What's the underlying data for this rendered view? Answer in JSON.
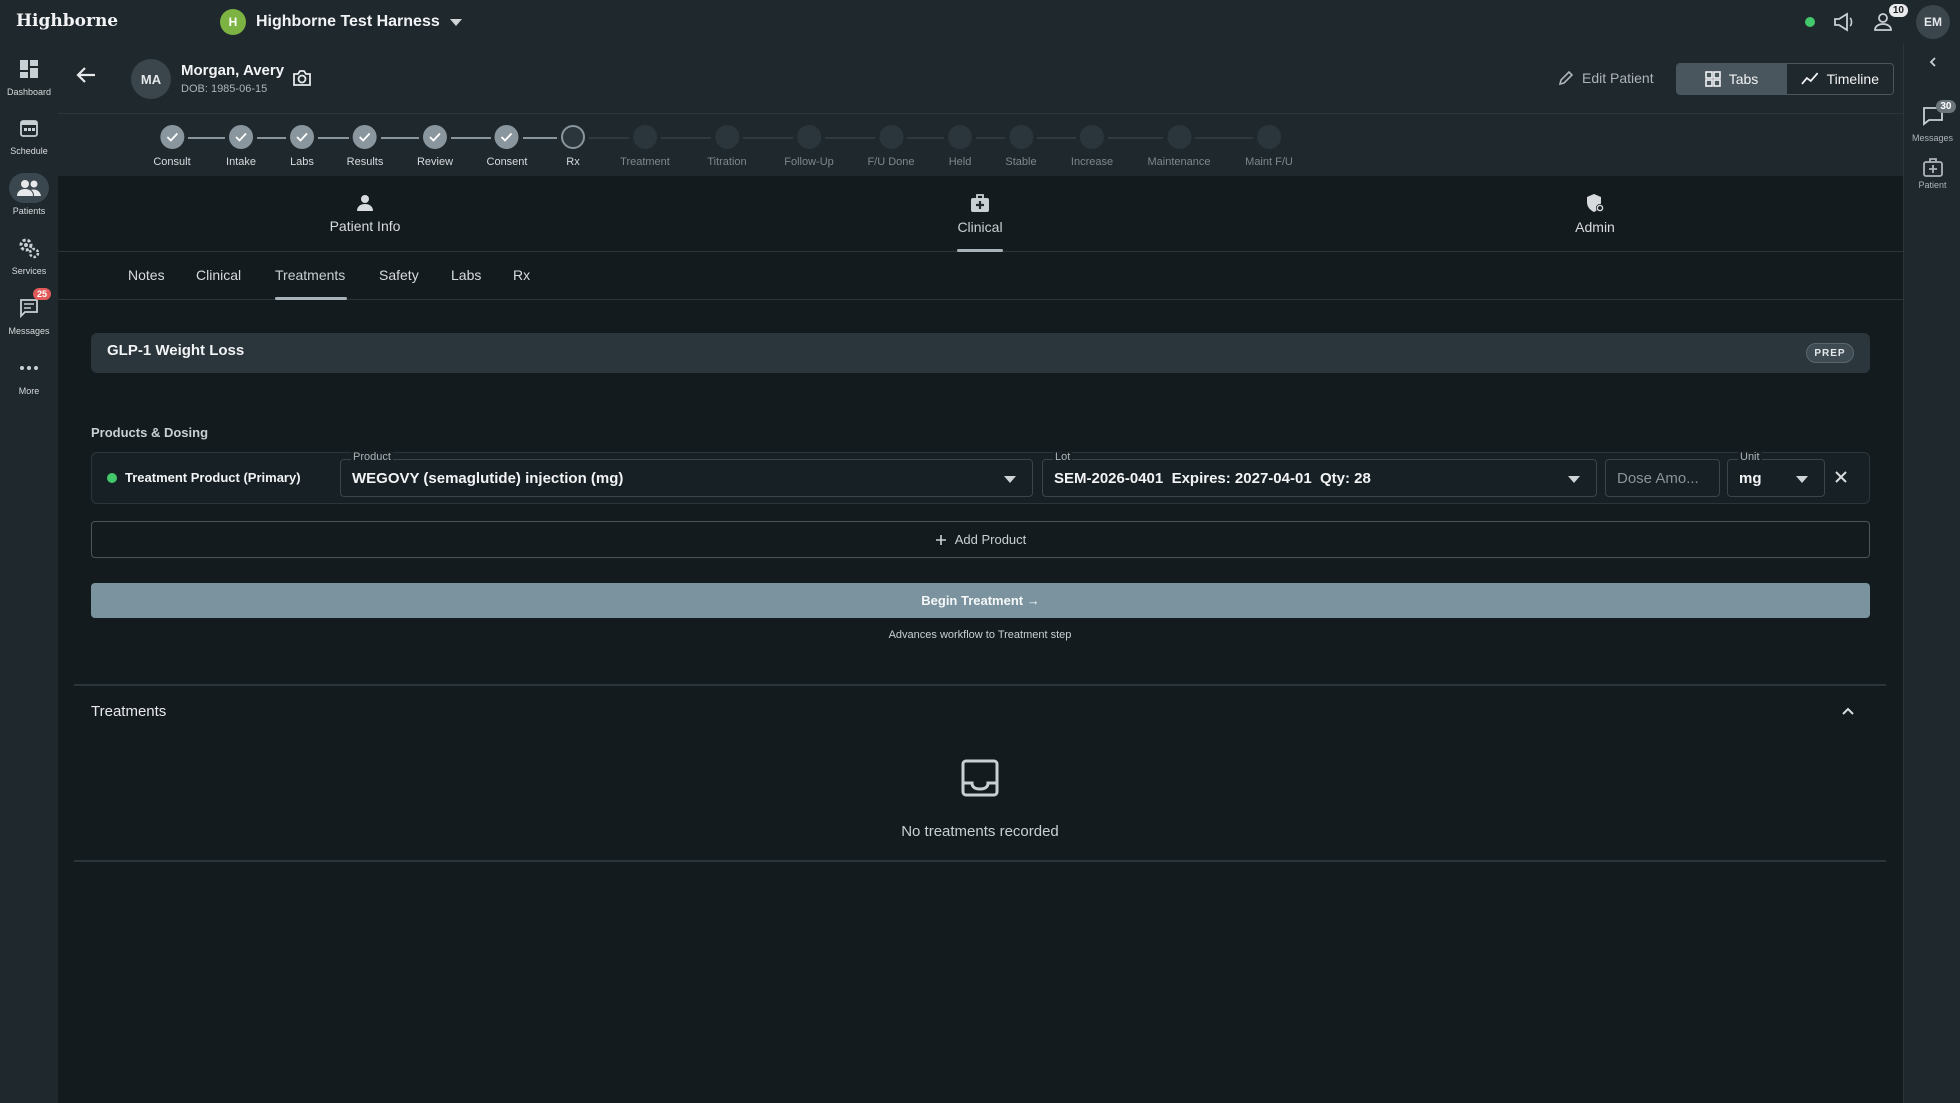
{
  "topbar": {
    "logo": "Highborne",
    "org_initial": "H",
    "org_name": "Highborne Test Harness",
    "notifications_count": "10",
    "user_initials": "EM"
  },
  "left_nav": [
    {
      "label": "Dashboard",
      "icon": "dashboard-icon"
    },
    {
      "label": "Schedule",
      "icon": "calendar-icon"
    },
    {
      "label": "Patients",
      "icon": "patients-icon",
      "active": true
    },
    {
      "label": "Services",
      "icon": "gears-icon"
    },
    {
      "label": "Messages",
      "icon": "chat-icon",
      "badge": "25"
    },
    {
      "label": "More",
      "icon": "more-icon"
    }
  ],
  "right_rail": {
    "messages_label": "Messages",
    "messages_badge": "30",
    "patient_label": "Patient"
  },
  "patient": {
    "initials": "MA",
    "name": "Morgan, Avery",
    "dob": "DOB: 1985-06-15"
  },
  "header_actions": {
    "edit_patient": "Edit Patient",
    "tabs_label": "Tabs",
    "timeline_label": "Timeline"
  },
  "workflow_steps": [
    {
      "label": "Consult",
      "state": "done"
    },
    {
      "label": "Intake",
      "state": "done"
    },
    {
      "label": "Labs",
      "state": "done"
    },
    {
      "label": "Results",
      "state": "done"
    },
    {
      "label": "Review",
      "state": "done"
    },
    {
      "label": "Consent",
      "state": "done"
    },
    {
      "label": "Rx",
      "state": "current"
    },
    {
      "label": "Treatment",
      "state": "todo"
    },
    {
      "label": "Titration",
      "state": "todo"
    },
    {
      "label": "Follow-Up",
      "state": "todo"
    },
    {
      "label": "F/U Done",
      "state": "todo"
    },
    {
      "label": "Held",
      "state": "todo"
    },
    {
      "label": "Stable",
      "state": "todo"
    },
    {
      "label": "Increase",
      "state": "todo"
    },
    {
      "label": "Maintenance",
      "state": "todo"
    },
    {
      "label": "Maint F/U",
      "state": "todo"
    }
  ],
  "main_tabs": [
    {
      "label": "Patient Info",
      "icon": "person-icon"
    },
    {
      "label": "Clinical",
      "icon": "medical-bag-icon",
      "active": true
    },
    {
      "label": "Admin",
      "icon": "shield-gear-icon"
    }
  ],
  "sub_tabs": [
    {
      "label": "Notes"
    },
    {
      "label": "Clinical"
    },
    {
      "label": "Treatments",
      "active": true
    },
    {
      "label": "Safety"
    },
    {
      "label": "Labs"
    },
    {
      "label": "Rx"
    }
  ],
  "program": {
    "title": "GLP-1 Weight Loss",
    "status_badge": "PREP"
  },
  "products_section": {
    "title": "Products & Dosing",
    "row": {
      "primary_label": "Treatment Product (Primary)",
      "product_label": "Product",
      "product_value": "WEGOVY (semaglutide) injection (mg)",
      "lot_label": "Lot",
      "lot_value": "SEM-2026-0401  Expires: 2027-04-01  Qty: 28",
      "dose_placeholder": "Dose Amo...",
      "unit_label": "Unit",
      "unit_value": "mg"
    },
    "add_product": "Add Product",
    "begin_button": "Begin Treatment →",
    "begin_help": "Advances workflow to Treatment step"
  },
  "treatments_section": {
    "title": "Treatments",
    "empty_text": "No treatments recorded"
  },
  "colors": {
    "background": "#141b1f",
    "panel": "#1f282d",
    "status_online": "#43c86b",
    "begin_button": "#7a939e",
    "org_badge": "#7cb342"
  }
}
